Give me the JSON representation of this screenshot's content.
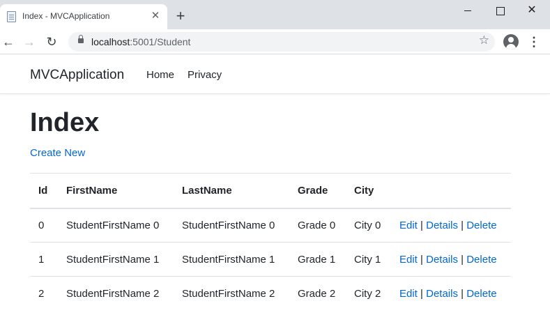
{
  "browser": {
    "tab_title": "Index - MVCApplication",
    "tab_close": "✕",
    "new_tab": "+",
    "url_host": "localhost",
    "url_rest": ":5001/Student",
    "window_close": "✕"
  },
  "site": {
    "brand": "MVCApplication",
    "nav": [
      "Home",
      "Privacy"
    ]
  },
  "page": {
    "title": "Index",
    "create_link": "Create New"
  },
  "table": {
    "headers": [
      "Id",
      "FirstName",
      "LastName",
      "Grade",
      "City",
      ""
    ],
    "rows": [
      [
        "0",
        "StudentFirstName 0",
        "StudentFirstName 0",
        "Grade 0",
        "City 0"
      ],
      [
        "1",
        "StudentFirstName 1",
        "StudentFirstName 1",
        "Grade 1",
        "City 1"
      ],
      [
        "2",
        "StudentFirstName 2",
        "StudentFirstName 2",
        "Grade 2",
        "City 2"
      ]
    ],
    "actions": [
      "Edit",
      "Details",
      "Delete"
    ],
    "separator": "|"
  },
  "icons": {
    "favicon": "page-icon",
    "back": "arrow-left-icon",
    "forward": "arrow-right-icon",
    "reload": "reload-icon",
    "lock": "lock-icon",
    "bookmark": "star-icon",
    "profile": "account-icon",
    "menu": "kebab-menu-icon"
  },
  "colors": {
    "link": "#0366d6",
    "tabstrip": "#dee1e6",
    "omnibox": "#f1f3f4"
  }
}
